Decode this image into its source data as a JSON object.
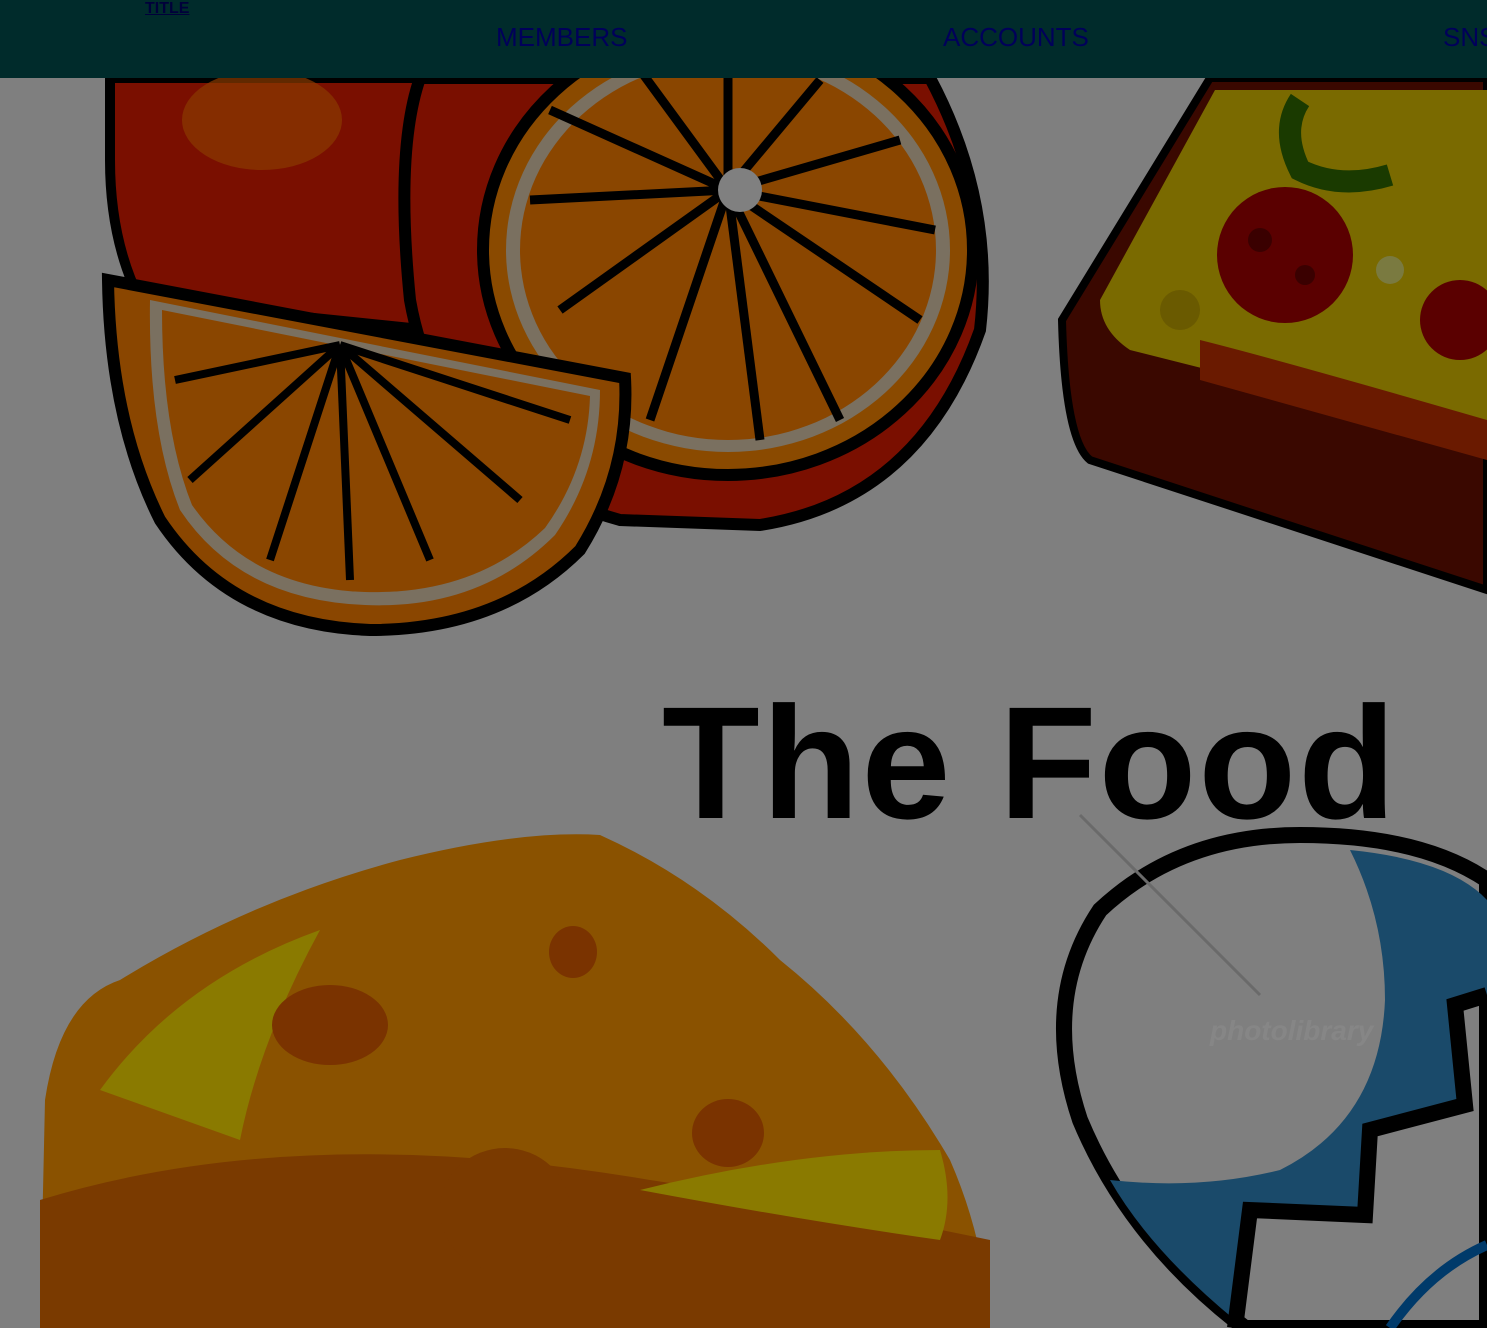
{
  "header": {
    "title": "TITLE",
    "nav": {
      "members": "MEMBERS",
      "accounts": "ACCOUNTS",
      "sns": "SNS"
    }
  },
  "hero": {
    "title": "The Food"
  },
  "colors": {
    "header_bg": "#002b2b",
    "page_bg": "#7f7f7f",
    "nav_text": "#00005a"
  },
  "illustrations": [
    "orange-slices-illustration",
    "pizza-slice-illustration",
    "cheese-wedge-illustration",
    "blue-egg-illustration"
  ]
}
